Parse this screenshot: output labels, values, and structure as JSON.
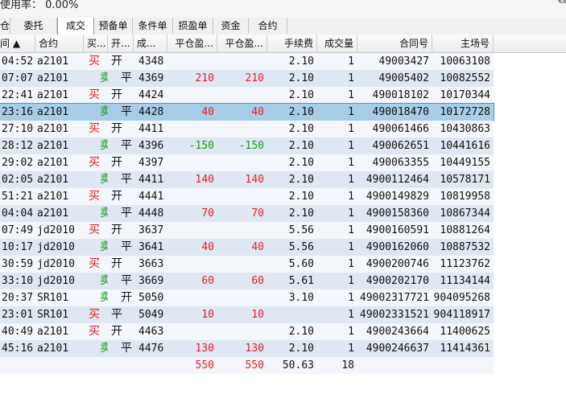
{
  "topbar": {
    "usage_text": "使用率： 0.00%",
    "corner_icon": "restore-window-icon"
  },
  "tabs": [
    {
      "label": "仓",
      "active": false
    },
    {
      "label": "委托",
      "active": false
    },
    {
      "label": "成交",
      "active": true
    },
    {
      "label": "预备单",
      "active": false
    },
    {
      "label": "条件单",
      "active": false
    },
    {
      "label": "损盈单",
      "active": false
    },
    {
      "label": "资金",
      "active": false
    },
    {
      "label": "合约",
      "active": false
    }
  ],
  "columns": [
    "间 ▲",
    "合约",
    "买...",
    "开...",
    "成...",
    "平仓盈...",
    "平仓盈...",
    "手续费",
    "成交量",
    "合同号",
    "主场号"
  ],
  "rows": [
    {
      "time": "04:52",
      "contract": "a2101",
      "buy": "买",
      "sell": "",
      "oc": "开",
      "price": "4348",
      "pnl1": "",
      "pnl2": "",
      "fee": "2.10",
      "vol": "1",
      "order": "49003427",
      "trade": "10063108"
    },
    {
      "time": "07:07",
      "contract": "a2101",
      "buy": "",
      "sell": "卖",
      "oc": "平",
      "price": "4369",
      "pnl1": "210",
      "pnl2": "210",
      "fee": "2.10",
      "vol": "1",
      "order": "49005402",
      "trade": "10082552"
    },
    {
      "time": "22:41",
      "contract": "a2101",
      "buy": "买",
      "sell": "",
      "oc": "开",
      "price": "4424",
      "pnl1": "",
      "pnl2": "",
      "fee": "2.10",
      "vol": "1",
      "order": "490018102",
      "trade": "10170344"
    },
    {
      "time": "23:16",
      "contract": "a2101",
      "buy": "",
      "sell": "卖",
      "oc": "平",
      "price": "4428",
      "pnl1": "40",
      "pnl2": "40",
      "fee": "2.10",
      "vol": "1",
      "order": "490018470",
      "trade": "10172728"
    },
    {
      "time": "27:10",
      "contract": "a2101",
      "buy": "买",
      "sell": "",
      "oc": "开",
      "price": "4411",
      "pnl1": "",
      "pnl2": "",
      "fee": "2.10",
      "vol": "1",
      "order": "490061466",
      "trade": "10430863"
    },
    {
      "time": "28:12",
      "contract": "a2101",
      "buy": "",
      "sell": "卖",
      "oc": "平",
      "price": "4396",
      "pnl1": "-150",
      "pnl2": "-150",
      "fee": "2.10",
      "vol": "1",
      "order": "490062651",
      "trade": "10441616"
    },
    {
      "time": "29:02",
      "contract": "a2101",
      "buy": "买",
      "sell": "",
      "oc": "开",
      "price": "4397",
      "pnl1": "",
      "pnl2": "",
      "fee": "2.10",
      "vol": "1",
      "order": "490063355",
      "trade": "10449155"
    },
    {
      "time": "02:05",
      "contract": "a2101",
      "buy": "",
      "sell": "卖",
      "oc": "平",
      "price": "4411",
      "pnl1": "140",
      "pnl2": "140",
      "fee": "2.10",
      "vol": "1",
      "order": "4900112464",
      "trade": "10578171"
    },
    {
      "time": "51:21",
      "contract": "a2101",
      "buy": "买",
      "sell": "",
      "oc": "开",
      "price": "4441",
      "pnl1": "",
      "pnl2": "",
      "fee": "2.10",
      "vol": "1",
      "order": "4900149829",
      "trade": "10819958"
    },
    {
      "time": "04:04",
      "contract": "a2101",
      "buy": "",
      "sell": "卖",
      "oc": "平",
      "price": "4448",
      "pnl1": "70",
      "pnl2": "70",
      "fee": "2.10",
      "vol": "1",
      "order": "4900158360",
      "trade": "10867344"
    },
    {
      "time": "07:49",
      "contract": "jd2010",
      "buy": "买",
      "sell": "",
      "oc": "开",
      "price": "3637",
      "pnl1": "",
      "pnl2": "",
      "fee": "5.56",
      "vol": "1",
      "order": "4900160591",
      "trade": "10881264"
    },
    {
      "time": "10:17",
      "contract": "jd2010",
      "buy": "",
      "sell": "卖",
      "oc": "平",
      "price": "3641",
      "pnl1": "40",
      "pnl2": "40",
      "fee": "5.56",
      "vol": "1",
      "order": "4900162060",
      "trade": "10887532"
    },
    {
      "time": "30:59",
      "contract": "jd2010",
      "buy": "买",
      "sell": "",
      "oc": "开",
      "price": "3663",
      "pnl1": "",
      "pnl2": "",
      "fee": "5.60",
      "vol": "1",
      "order": "4900200746",
      "trade": "11123762"
    },
    {
      "time": "33:10",
      "contract": "jd2010",
      "buy": "",
      "sell": "卖",
      "oc": "平",
      "price": "3669",
      "pnl1": "60",
      "pnl2": "60",
      "fee": "5.61",
      "vol": "1",
      "order": "4900202170",
      "trade": "11134144"
    },
    {
      "time": "20:37",
      "contract": "SR101",
      "buy": "",
      "sell": "卖",
      "oc": "开",
      "price": "5050",
      "pnl1": "",
      "pnl2": "",
      "fee": "3.10",
      "vol": "1",
      "order": "49002317721",
      "trade": "904095268"
    },
    {
      "time": "23:01",
      "contract": "SR101",
      "buy": "买",
      "sell": "",
      "oc": "平",
      "price": "5049",
      "pnl1": "10",
      "pnl2": "10",
      "fee": "",
      "vol": "1",
      "order": "49002331521",
      "trade": "904118917"
    },
    {
      "time": "40:49",
      "contract": "a2101",
      "buy": "买",
      "sell": "",
      "oc": "开",
      "price": "4463",
      "pnl1": "",
      "pnl2": "",
      "fee": "2.10",
      "vol": "1",
      "order": "4900243664",
      "trade": "11400625"
    },
    {
      "time": "45:16",
      "contract": "a2101",
      "buy": "",
      "sell": "卖",
      "oc": "平",
      "price": "4476",
      "pnl1": "130",
      "pnl2": "130",
      "fee": "2.10",
      "vol": "1",
      "order": "4900246637",
      "trade": "11414361"
    }
  ],
  "totals": {
    "pnl1": "550",
    "pnl2": "550",
    "fee": "50.63",
    "vol": "18"
  },
  "selected_row": 3,
  "colors": {
    "buy": "#e0202a",
    "sell": "#1a9a1a",
    "selected": "#a8cde6"
  }
}
